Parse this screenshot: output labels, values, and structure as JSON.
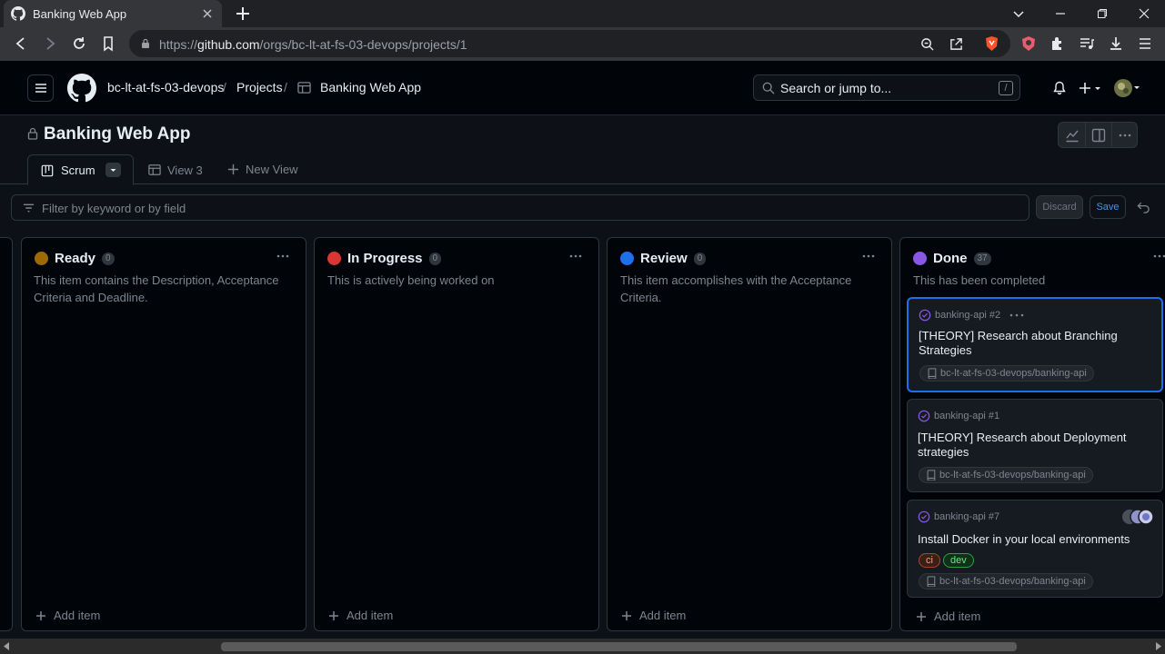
{
  "browser": {
    "tab_title": "Banking Web App",
    "url_prefix": "https://",
    "url_host": "github.com",
    "url_path": "/orgs/bc-lt-at-fs-03-devops/projects/1"
  },
  "header": {
    "org": "bc-lt-at-fs-03-devops",
    "sep1": "/",
    "projects": "Projects",
    "sep2": "/",
    "project": "Banking Web App",
    "search_placeholder": "Search or jump to...",
    "search_kbd": "/"
  },
  "project": {
    "title": "Banking Web App",
    "views": [
      {
        "label": "Scrum"
      },
      {
        "label": "View 3"
      },
      {
        "label": "New View"
      }
    ],
    "filter_placeholder": "Filter by keyword or by field",
    "discard_label": "Discard",
    "save_label": "Save"
  },
  "columns": [
    {
      "name": "Ready",
      "count": "0",
      "color": "#9e6a03",
      "description": "This item contains the Description, Acceptance Criteria and Deadline.",
      "add_label": "Add item"
    },
    {
      "name": "In Progress",
      "count": "0",
      "color": "#da3633",
      "description": "This is actively being worked on",
      "add_label": "Add item"
    },
    {
      "name": "Review",
      "count": "0",
      "color": "#1f6feb",
      "description": "This item accomplishes with the Acceptance Criteria.",
      "add_label": "Add item"
    },
    {
      "name": "Done",
      "count": "37",
      "color": "#8957e5",
      "description": "This has been completed",
      "add_label": "Add item"
    }
  ],
  "cards": [
    {
      "ref": "banking-api #2",
      "title": "[THEORY] Research about Branching Strategies",
      "repo": "bc-lt-at-fs-03-devops/banking-api"
    },
    {
      "ref": "banking-api #1",
      "title": "[THEORY] Research about Deployment strategies",
      "repo": "bc-lt-at-fs-03-devops/banking-api"
    },
    {
      "ref": "banking-api #7",
      "title": "Install Docker in your local environments",
      "repo": "bc-lt-at-fs-03-devops/banking-api",
      "labels": [
        "ci",
        "dev"
      ]
    }
  ],
  "colors": {
    "accent": "#1f6feb",
    "done_icon": "#8957e5"
  }
}
